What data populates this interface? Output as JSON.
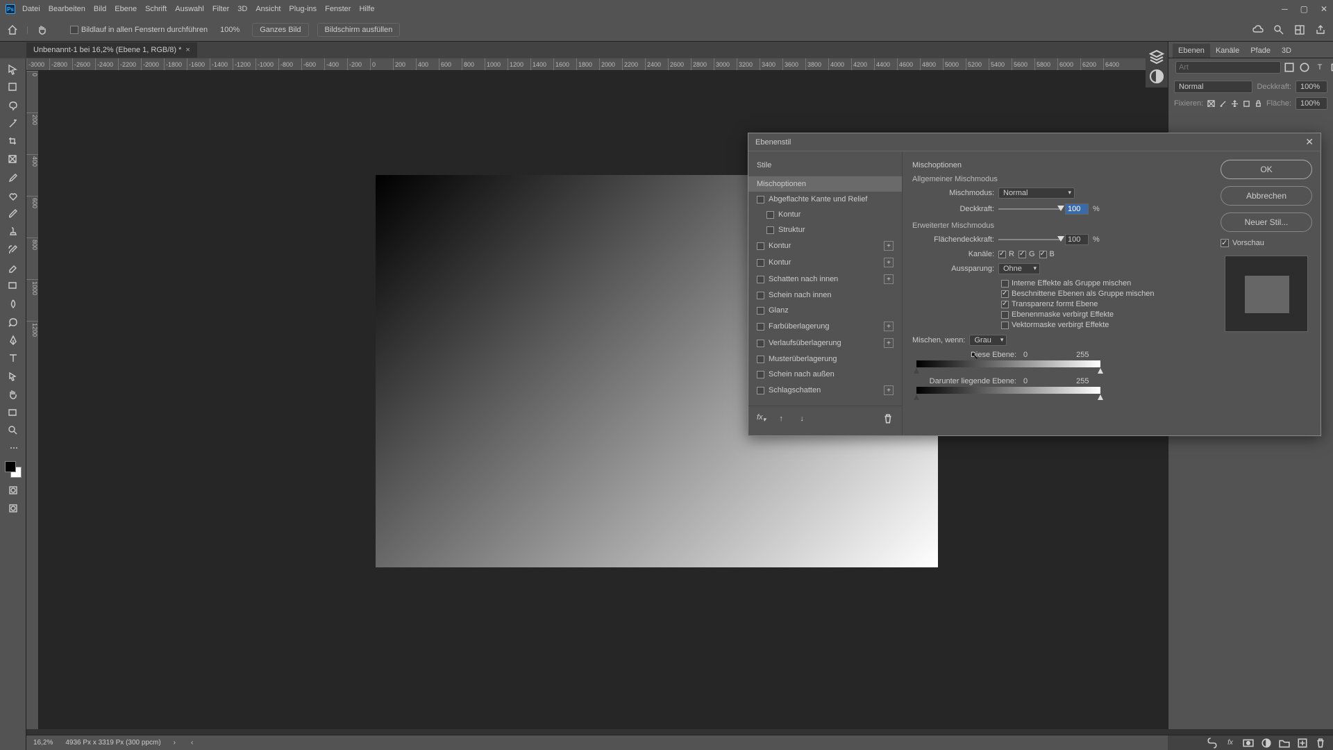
{
  "menu": {
    "items": [
      "Datei",
      "Bearbeiten",
      "Bild",
      "Ebene",
      "Schrift",
      "Auswahl",
      "Filter",
      "3D",
      "Ansicht",
      "Plug-ins",
      "Fenster",
      "Hilfe"
    ]
  },
  "optbar": {
    "scroll_all": "Bildlauf in allen Fenstern durchführen",
    "zoom": "100%",
    "whole_img": "Ganzes Bild",
    "fill_screen": "Bildschirm ausfüllen"
  },
  "doc": {
    "tab_title": "Unbenannt-1 bei 16,2% (Ebene 1, RGB/8) *"
  },
  "ruler": {
    "marks": [
      "-3000",
      "-2800",
      "-2600",
      "-2400",
      "-2200",
      "-2000",
      "-1800",
      "-1600",
      "-1400",
      "-1200",
      "-1000",
      "-800",
      "-600",
      "-400",
      "-200",
      "0",
      "200",
      "400",
      "600",
      "800",
      "1000",
      "1200",
      "1400",
      "1600",
      "1800",
      "2000",
      "2200",
      "2400",
      "2600",
      "2800",
      "3000",
      "3200",
      "3400",
      "3600",
      "3800",
      "4000",
      "4200",
      "4400",
      "4600",
      "4800",
      "5000",
      "5200",
      "5400",
      "5600",
      "5800",
      "6000",
      "6200",
      "6400"
    ],
    "vmarks": [
      "0",
      "200",
      "400",
      "600",
      "800",
      "1000",
      "1200"
    ]
  },
  "panels": {
    "tabs": [
      "Ebenen",
      "Kanäle",
      "Pfade",
      "3D"
    ],
    "search_ph": "Art",
    "blend_mode": "Normal",
    "opacity_label": "Deckkraft:",
    "opacity_val": "100%",
    "lock_label": "Fixieren:",
    "fill_label": "Fläche:",
    "fill_val": "100%"
  },
  "status": {
    "zoom": "16,2%",
    "info": "4936 Px x 3319 Px (300 ppcm)"
  },
  "dialog": {
    "title": "Ebenenstil",
    "styles_header": "Stile",
    "styles": [
      {
        "key": "mix",
        "label": "Mischoptionen",
        "selected": true,
        "cb": false
      },
      {
        "key": "bevel",
        "label": "Abgeflachte Kante und Relief",
        "cb": true
      },
      {
        "key": "kontur1",
        "label": "Kontur",
        "sub": true,
        "cb": true
      },
      {
        "key": "struktur",
        "label": "Struktur",
        "sub": true,
        "cb": true
      },
      {
        "key": "kontur2",
        "label": "Kontur",
        "cb": true,
        "plus": true
      },
      {
        "key": "kontur3",
        "label": "Kontur",
        "cb": true,
        "plus": true
      },
      {
        "key": "innershadow",
        "label": "Schatten nach innen",
        "cb": true,
        "plus": true
      },
      {
        "key": "innerglow",
        "label": "Schein nach innen",
        "cb": true
      },
      {
        "key": "glanz",
        "label": "Glanz",
        "cb": true
      },
      {
        "key": "colorover",
        "label": "Farbüberlagerung",
        "cb": true,
        "plus": true
      },
      {
        "key": "gradover",
        "label": "Verlaufsüberlagerung",
        "cb": true,
        "plus": true
      },
      {
        "key": "patover",
        "label": "Musterüberlagerung",
        "cb": true
      },
      {
        "key": "outerglow",
        "label": "Schein nach außen",
        "cb": true
      },
      {
        "key": "dropshadow",
        "label": "Schlagschatten",
        "cb": true,
        "plus": true
      }
    ],
    "opts": {
      "section": "Mischoptionen",
      "general": "Allgemeiner Mischmodus",
      "mode_label": "Mischmodus:",
      "mode_val": "Normal",
      "opacity_label": "Deckkraft:",
      "opacity_val": "100",
      "pct": "%",
      "advanced": "Erweiterter Mischmodus",
      "fill_label": "Flächendeckkraft:",
      "fill_val": "100",
      "channels_label": "Kanäle:",
      "ch_r": "R",
      "ch_g": "G",
      "ch_b": "B",
      "knockout_label": "Aussparung:",
      "knockout_val": "Ohne",
      "cb1": "Interne Effekte als Gruppe mischen",
      "cb2": "Beschnittene Ebenen als Gruppe mischen",
      "cb3": "Transparenz formt Ebene",
      "cb4": "Ebenenmaske verbirgt Effekte",
      "cb5": "Vektormaske verbirgt Effekte",
      "blendif_label": "Mischen, wenn:",
      "blendif_val": "Grau",
      "this_label": "Diese Ebene:",
      "this_lo": "0",
      "this_hi": "255",
      "under_label": "Darunter liegende Ebene:",
      "under_lo": "0",
      "under_hi": "255"
    },
    "btns": {
      "ok": "OK",
      "cancel": "Abbrechen",
      "new": "Neuer Stil...",
      "preview": "Vorschau"
    }
  }
}
